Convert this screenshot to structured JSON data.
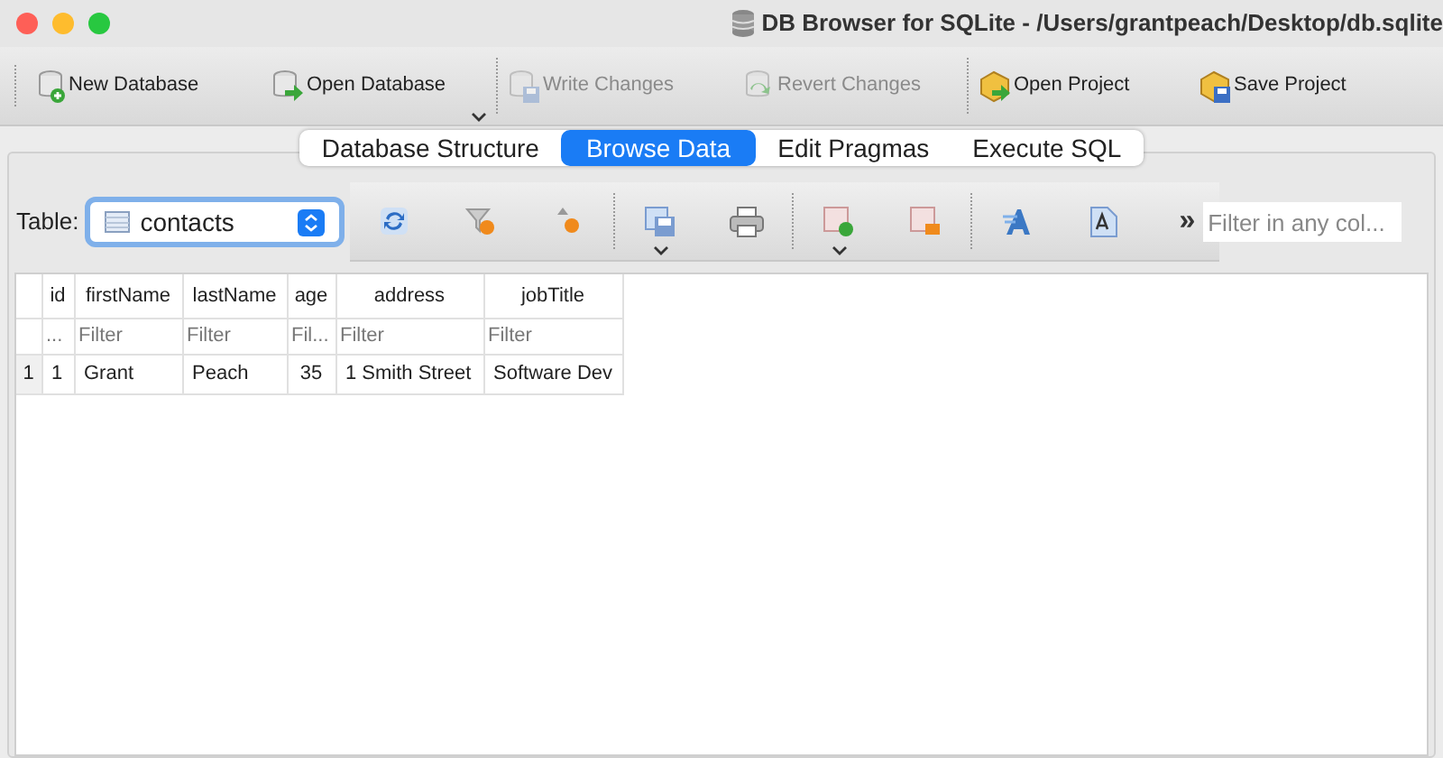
{
  "window": {
    "title": "DB Browser for SQLite - /Users/grantpeach/Desktop/db.sqlite"
  },
  "toolbar": [
    {
      "label": "New Database",
      "disabled": false,
      "menu": false
    },
    {
      "label": "Open Database",
      "disabled": false,
      "menu": true
    },
    {
      "label": "Write Changes",
      "disabled": true,
      "menu": false
    },
    {
      "label": "Revert Changes",
      "disabled": true,
      "menu": false
    },
    {
      "label": "Open Project",
      "disabled": false,
      "menu": false
    },
    {
      "label": "Save Project",
      "disabled": false,
      "menu": false
    }
  ],
  "tabs": [
    {
      "label": "Database Structure",
      "selected": false
    },
    {
      "label": "Browse Data",
      "selected": true
    },
    {
      "label": "Edit Pragmas",
      "selected": false
    },
    {
      "label": "Execute SQL",
      "selected": false
    }
  ],
  "table_selector": {
    "label": "Table:",
    "value": "contacts"
  },
  "data_toolbar": [
    [
      {
        "menu": false
      },
      {
        "menu": false
      },
      {
        "menu": false
      }
    ],
    [
      {
        "menu": true
      },
      {
        "menu": false
      }
    ],
    [
      {
        "menu": true
      },
      {
        "menu": false
      }
    ],
    [
      {
        "menu": false
      },
      {
        "menu": false
      }
    ]
  ],
  "overflow": "»",
  "global_filter": {
    "placeholder": "Filter in any col..."
  },
  "grid": {
    "columns": [
      "id",
      "firstName",
      "lastName",
      "age",
      "address",
      "jobTitle"
    ],
    "filters": [
      {
        "placeholder": "..."
      },
      {
        "placeholder": "Filter"
      },
      {
        "placeholder": "Filter"
      },
      {
        "placeholder": "Fil..."
      },
      {
        "placeholder": "Filter"
      },
      {
        "placeholder": "Filter"
      }
    ],
    "rows": [
      {
        "number": "1",
        "cells": [
          "1",
          "Grant",
          "Peach",
          "35",
          "1 Smith Street",
          "Software Dev"
        ]
      }
    ]
  }
}
